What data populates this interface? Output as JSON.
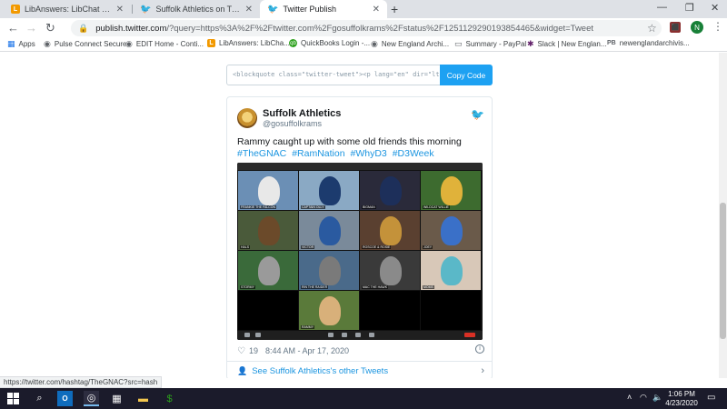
{
  "browser": {
    "tabs": [
      {
        "label": "LibAnswers: LibChat Dashboard",
        "active": false
      },
      {
        "label": "Suffolk Athletics on Twitter: \"Ram",
        "active": false
      },
      {
        "label": "Twitter Publish",
        "active": true
      }
    ],
    "url_host": "publish.twitter.com",
    "url_rest": "/?query=https%3A%2F%2Ftwitter.com%2Fgosuffolkrams%2Fstatus%2F1251129290193854465&widget=Tweet",
    "profile_initial": "N",
    "bookmarks": [
      {
        "label": "Apps",
        "icon": "apps-grid-icon"
      },
      {
        "label": "Pulse Connect Secure",
        "icon": "globe-icon"
      },
      {
        "label": "EDIT Home - Conti...",
        "icon": "globe-icon"
      },
      {
        "label": "LibAnswers: LibCha...",
        "icon": "libanswers-icon"
      },
      {
        "label": "QuickBooks Login -...",
        "icon": "quickbooks-icon"
      },
      {
        "label": "New England Archi...",
        "icon": "globe-icon"
      },
      {
        "label": "Summary - PayPal",
        "icon": "document-icon"
      },
      {
        "label": "Slack | New Englan...",
        "icon": "slack-icon"
      },
      {
        "label": "newenglandarchivis...",
        "icon": "pb-icon"
      }
    ]
  },
  "embed": {
    "code": "<blockquote class=\"twitter-tweet\"><p lang=\"en\" dir=\"ltr\">Rammy caught up with some old friends this morning",
    "copy_label": "Copy Code"
  },
  "tweet": {
    "name": "Suffolk Athletics",
    "handle": "@gosuffolkrams",
    "text": "Rammy caught up with some old friends this morning",
    "hashtags": [
      "#TheGNAC",
      "#RamNation",
      "#WhyD3",
      "#D3Week"
    ],
    "likes": "19",
    "timestamp": "8:44 AM - Apr 17, 2020",
    "see_more": "See Suffolk Athletics's other Tweets",
    "media_tiles": [
      {
        "label": "FRANKIE THE FALCON",
        "bg": "#6b8fb5",
        "fg": "#e8e8e8"
      },
      {
        "label": "CAPTAIN OLLY",
        "bg": "#8aa9c4",
        "fg": "#1c3b6e"
      },
      {
        "label": "BIGMAN",
        "bg": "#2a2a3a",
        "fg": "#1d2f5a"
      },
      {
        "label": "WILDCAT WILLIE",
        "bg": "#3d6b2f",
        "fg": "#e0b23a"
      },
      {
        "label": "HALS",
        "bg": "#4a5a3a",
        "fg": "#6b4a2a"
      },
      {
        "label": "VICTOR",
        "bg": "#7a8a9a",
        "fg": "#2a5aa0"
      },
      {
        "label": "ROSCOE & ROSIE",
        "bg": "#5a4030",
        "fg": "#c4923a"
      },
      {
        "label": "JOEY",
        "bg": "#6a5a4a",
        "fg": "#3a70c8"
      },
      {
        "label": "STORMY",
        "bg": "#3a6a3a",
        "fg": "#9a9a9a"
      },
      {
        "label": "RIN THE RAIDER",
        "bg": "#4a6a8a",
        "fg": "#7a7a7a"
      },
      {
        "label": "MAC THE HAWK",
        "bg": "#3a3a3a",
        "fg": "#8a8a8a"
      },
      {
        "label": "MOMS",
        "bg": "#d8c8b8",
        "fg": "#5ab8c8"
      },
      {
        "label": "",
        "bg": "#000000",
        "fg": "#000000"
      },
      {
        "label": "RAMMY",
        "bg": "#5a7a3a",
        "fg": "#d8b07a"
      },
      {
        "label": "",
        "bg": "#000000",
        "fg": "#000000"
      },
      {
        "label": "",
        "bg": "#000000",
        "fg": "#000000"
      }
    ]
  },
  "status_url": "https://twitter.com/hashtag/TheGNAC?src=hash",
  "taskbar": {
    "time": "1:06 PM",
    "date": "4/23/2020"
  }
}
